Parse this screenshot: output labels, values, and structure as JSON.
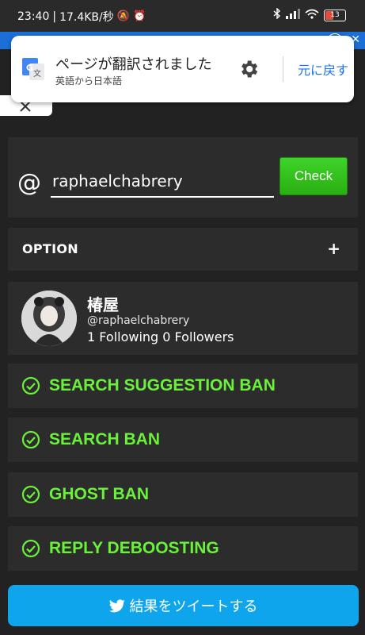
{
  "statusbar": {
    "time": "23:40",
    "speed": "17.4KB/秒",
    "battery": "13"
  },
  "translate_banner": {
    "title": "ページが翻訳されました",
    "subtitle": "英語から日本語",
    "revert": "元に戻す"
  },
  "search": {
    "at_symbol": "@",
    "username": "raphaelchabrery",
    "check_label": "Check"
  },
  "option": {
    "label": "OPTION",
    "toggle": "+"
  },
  "profile": {
    "name": "椿屋",
    "handle": "@raphaelchabrery",
    "stats": "1 Following 0 Followers"
  },
  "bans": [
    {
      "label": "SEARCH SUGGESTION BAN"
    },
    {
      "label": "SEARCH BAN"
    },
    {
      "label": "GHOST BAN"
    },
    {
      "label": "REPLY DEBOOSTING"
    }
  ],
  "tweet": {
    "label": "結果をツイートする"
  },
  "colors": {
    "ok_green": "#6af23a",
    "check_green": "#2aae12",
    "twitter_blue": "#0fa5ec",
    "card_bg": "#2c2c2c",
    "page_bg": "#222222"
  }
}
